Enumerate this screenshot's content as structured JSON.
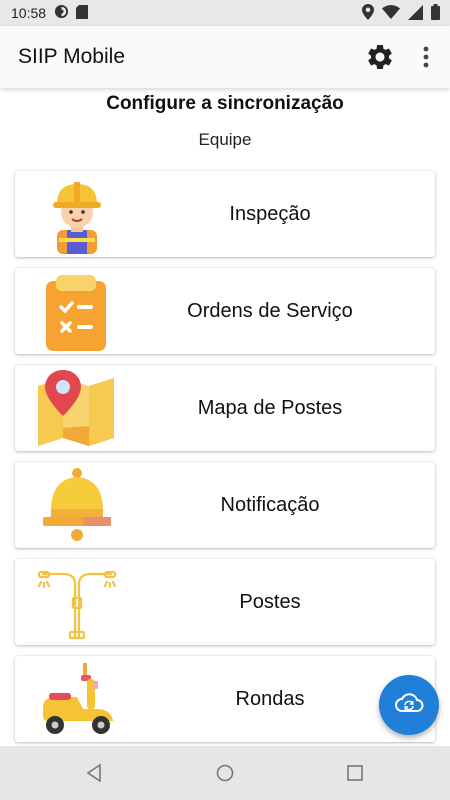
{
  "status_bar": {
    "time": "10:58",
    "icons_left": [
      "sync-icon",
      "sd-card-icon"
    ],
    "icons_right": [
      "location-icon",
      "wifi-icon",
      "signal-icon",
      "battery-icon"
    ]
  },
  "app_bar": {
    "title": "SIIP Mobile",
    "actions": [
      "gear-icon",
      "more-vert-icon"
    ]
  },
  "page": {
    "title": "Configure a sincronização",
    "subtitle": "Equipe"
  },
  "menu_items": [
    {
      "label": "Inspeção",
      "icon": "worker-icon"
    },
    {
      "label": "Ordens de Serviço",
      "icon": "clipboard-icon"
    },
    {
      "label": "Mapa de Postes",
      "icon": "map-icon"
    },
    {
      "label": "Notificação",
      "icon": "bell-icon"
    },
    {
      "label": "Postes",
      "icon": "street-light-icon"
    },
    {
      "label": "Rondas",
      "icon": "scooter-icon"
    }
  ],
  "fab": {
    "icon": "cloud-sync-icon"
  },
  "nav_bar": {
    "buttons": [
      "back-icon",
      "home-icon",
      "recents-icon"
    ]
  },
  "colors": {
    "accent": "#1f7fd9",
    "yellow": "#f6c335",
    "orange": "#f4a23a"
  }
}
